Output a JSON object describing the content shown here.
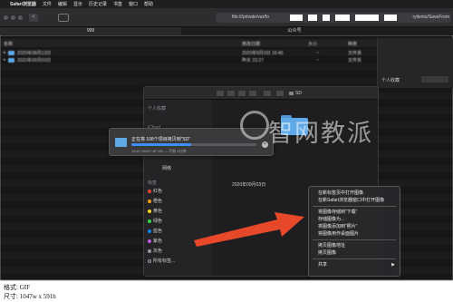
{
  "menubar": {
    "apple": "",
    "app": "Safari浏览器",
    "items": [
      "文件",
      "编辑",
      "显示",
      "历史记录",
      "书签",
      "窗口",
      "帮助"
    ]
  },
  "toolbar": {
    "back": "<",
    "forward": ">",
    "address_start": "file:///private/var/fo",
    "address_end": "ryitems/SaveFrom"
  },
  "tabs": [
    {
      "label": "999"
    },
    {
      "label": "公众号"
    }
  ],
  "listing": {
    "columns": {
      "name": "名称",
      "modified": "修改日期",
      "size": "大小",
      "kind": "种类"
    },
    "rows": [
      {
        "name": "2020年08月13日",
        "modified": "2020年9月3日 16:45",
        "size": "--",
        "kind": "文件夹"
      },
      {
        "name": "2020年09月03日",
        "modified": "昨天 23:27",
        "size": "--",
        "kind": "文件夹"
      }
    ]
  },
  "right_panel": {
    "label": "个人收藏"
  },
  "finder": {
    "title": "SD",
    "sidebar": {
      "favorites": "个人收藏",
      "icloud": "iCloud",
      "network": "网络",
      "tags_header": "标签",
      "tags": [
        {
          "label": "红色",
          "color": "#ff453a"
        },
        {
          "label": "橙色",
          "color": "#ff9f0a"
        },
        {
          "label": "黄色",
          "color": "#ffd60a"
        },
        {
          "label": "绿色",
          "color": "#32d74b"
        },
        {
          "label": "蓝色",
          "color": "#0a84ff"
        },
        {
          "label": "紫色",
          "color": "#bf5af2"
        },
        {
          "label": "灰色",
          "color": "#98989d"
        }
      ],
      "all_tags": "所有标签..."
    },
    "folder_label": "2020年09月03日"
  },
  "copy_dialog": {
    "message": "正在将 108个项目拷贝到“SD”",
    "detail": "13.67 GB/27.87 GB — 不到 1分钟",
    "progress": 0.48,
    "cancel": "×"
  },
  "watermark": "智网教派",
  "context_menu": {
    "groups": [
      [
        "在新标签页中打开图像",
        "在新Safari浏览器窗口中打开图像"
      ],
      [
        "将图像存储到“下载”",
        "存储图像为...",
        "将图像添加到“照片”",
        "将图像用作桌面图片"
      ],
      [
        "拷贝图像地址",
        "拷贝图像"
      ],
      [
        "共享"
      ]
    ],
    "submenu_arrow": "▶"
  },
  "caption": {
    "format": "格式: GIF",
    "size": "尺寸: 1047w x 591h"
  },
  "colors": {
    "accent": "#3e8ef7",
    "arrow": "#e8482a"
  }
}
